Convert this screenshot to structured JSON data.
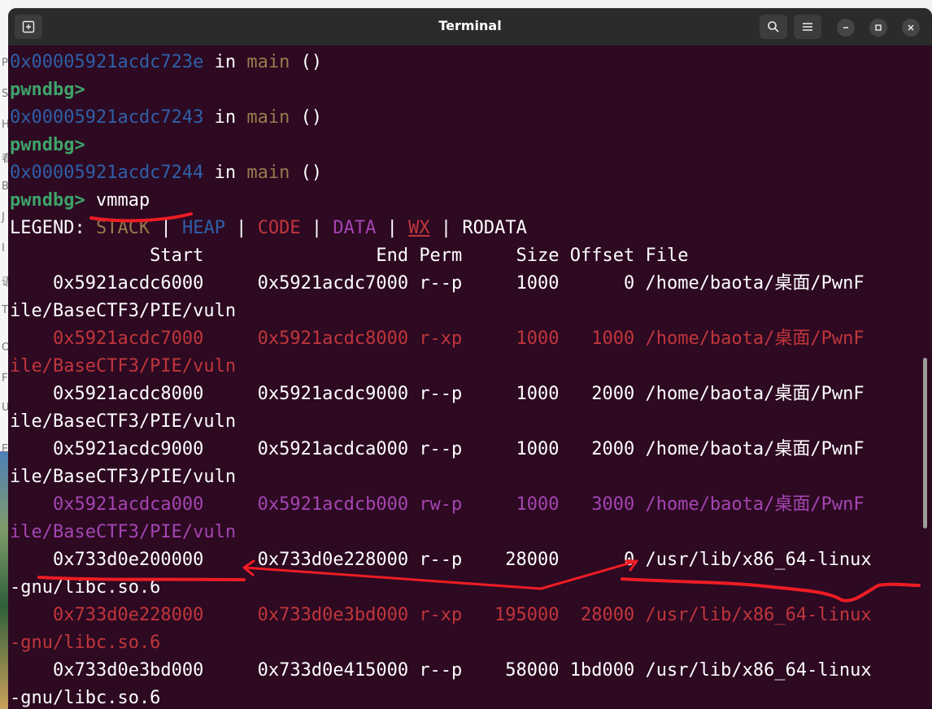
{
  "window": {
    "title": "Terminal"
  },
  "icons": {
    "new_tab": "new-tab-icon",
    "search": "search-icon",
    "menu": "hamburger-menu-icon",
    "minimize": "minimize-icon",
    "maximize": "maximize-icon",
    "close": "close-icon"
  },
  "colors": {
    "background": "#2d0922",
    "titlebar": "#2b2b2b",
    "address_blue": "#2f60a8",
    "function_brown": "#9a7a4c",
    "prompt_green": "#3ea36a",
    "code_red": "#c0363b",
    "data_purple": "#a445b2",
    "annotation_red": "#ee1c24"
  },
  "bg_chars": [
    "P",
    "S",
    "H",
    "春",
    "B",
    "J",
    "I",
    "语",
    "T",
    "O",
    "F",
    "U",
    "E"
  ],
  "terminal": {
    "lines": [
      {
        "segments": [
          {
            "t": "0x00005921acdc723e",
            "c": "blue"
          },
          {
            "t": " in ",
            "c": "white"
          },
          {
            "t": "main",
            "c": "brown"
          },
          {
            "t": " ()",
            "c": "white"
          }
        ]
      },
      {
        "segments": [
          {
            "t": "pwndbg>",
            "c": "green"
          }
        ]
      },
      {
        "segments": [
          {
            "t": "0x00005921acdc7243",
            "c": "blue"
          },
          {
            "t": " in ",
            "c": "white"
          },
          {
            "t": "main",
            "c": "brown"
          },
          {
            "t": " ()",
            "c": "white"
          }
        ]
      },
      {
        "segments": [
          {
            "t": "pwndbg>",
            "c": "green"
          }
        ]
      },
      {
        "segments": [
          {
            "t": "0x00005921acdc7244",
            "c": "blue"
          },
          {
            "t": " in ",
            "c": "white"
          },
          {
            "t": "main",
            "c": "brown"
          },
          {
            "t": " ()",
            "c": "white"
          }
        ]
      },
      {
        "segments": [
          {
            "t": "pwndbg>",
            "c": "green"
          },
          {
            "t": " vmmap",
            "c": "white"
          }
        ]
      },
      {
        "segments": [
          {
            "t": "LEGEND: ",
            "c": "white"
          },
          {
            "t": "STACK",
            "c": "brown"
          },
          {
            "t": " | ",
            "c": "white"
          },
          {
            "t": "HEAP",
            "c": "blue"
          },
          {
            "t": " | ",
            "c": "white"
          },
          {
            "t": "CODE",
            "c": "red"
          },
          {
            "t": " | ",
            "c": "white"
          },
          {
            "t": "DATA",
            "c": "purple"
          },
          {
            "t": " | ",
            "c": "white"
          },
          {
            "t": "WX",
            "c": "wx"
          },
          {
            "t": " | ",
            "c": "white"
          },
          {
            "t": "RODATA",
            "c": "white"
          }
        ]
      },
      {
        "segments": [
          {
            "t": "             Start                End Perm     Size Offset File",
            "c": "white"
          }
        ]
      },
      {
        "segments": [
          {
            "t": "    0x5921acdc6000     0x5921acdc7000 r--p     1000      0 /home/baota/桌面/PwnF",
            "c": "white"
          }
        ]
      },
      {
        "segments": [
          {
            "t": "ile/BaseCTF3/PIE/vuln",
            "c": "white"
          }
        ]
      },
      {
        "segments": [
          {
            "t": "    0x5921acdc7000     0x5921acdc8000 r-xp     1000   1000 /home/baota/桌面/PwnF",
            "c": "red"
          }
        ]
      },
      {
        "segments": [
          {
            "t": "ile/BaseCTF3/PIE/vuln",
            "c": "red"
          }
        ]
      },
      {
        "segments": [
          {
            "t": "    0x5921acdc8000     0x5921acdc9000 r--p     1000   2000 /home/baota/桌面/PwnF",
            "c": "white"
          }
        ]
      },
      {
        "segments": [
          {
            "t": "ile/BaseCTF3/PIE/vuln",
            "c": "white"
          }
        ]
      },
      {
        "segments": [
          {
            "t": "    0x5921acdc9000     0x5921acdca000 r--p     1000   2000 /home/baota/桌面/PwnF",
            "c": "white"
          }
        ]
      },
      {
        "segments": [
          {
            "t": "ile/BaseCTF3/PIE/vuln",
            "c": "white"
          }
        ]
      },
      {
        "segments": [
          {
            "t": "    0x5921acdca000     0x5921acdcb000 rw-p     1000   3000 /home/baota/桌面/PwnF",
            "c": "purple"
          }
        ]
      },
      {
        "segments": [
          {
            "t": "ile/BaseCTF3/PIE/vuln",
            "c": "purple"
          }
        ]
      },
      {
        "segments": [
          {
            "t": "    0x733d0e200000     0x733d0e228000 r--p    28000      0 /usr/lib/x86_64-linux",
            "c": "white"
          }
        ]
      },
      {
        "segments": [
          {
            "t": "-gnu/libc.so.6",
            "c": "white"
          }
        ]
      },
      {
        "segments": [
          {
            "t": "    0x733d0e228000     0x733d0e3bd000 r-xp   195000  28000 /usr/lib/x86_64-linux",
            "c": "red"
          }
        ]
      },
      {
        "segments": [
          {
            "t": "-gnu/libc.so.6",
            "c": "red"
          }
        ]
      },
      {
        "segments": [
          {
            "t": "    0x733d0e3bd000     0x733d0e415000 r--p    58000 1bd000 /usr/lib/x86_64-linux",
            "c": "white"
          }
        ]
      },
      {
        "segments": [
          {
            "t": "-gnu/libc.so.6",
            "c": "white"
          }
        ]
      }
    ]
  }
}
